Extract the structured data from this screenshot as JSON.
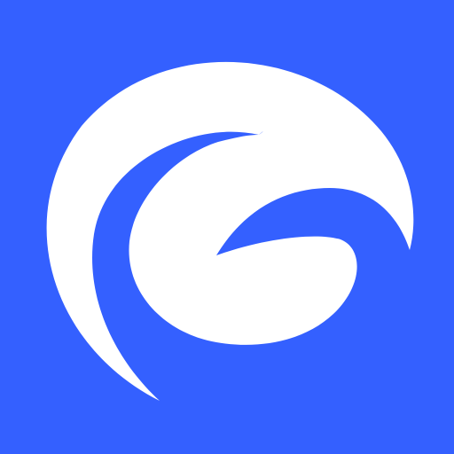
{
  "logo": {
    "icon": "wave-swirl-logo-icon",
    "colors": {
      "background": "#3460FF",
      "foreground": "#FFFFFF"
    }
  }
}
